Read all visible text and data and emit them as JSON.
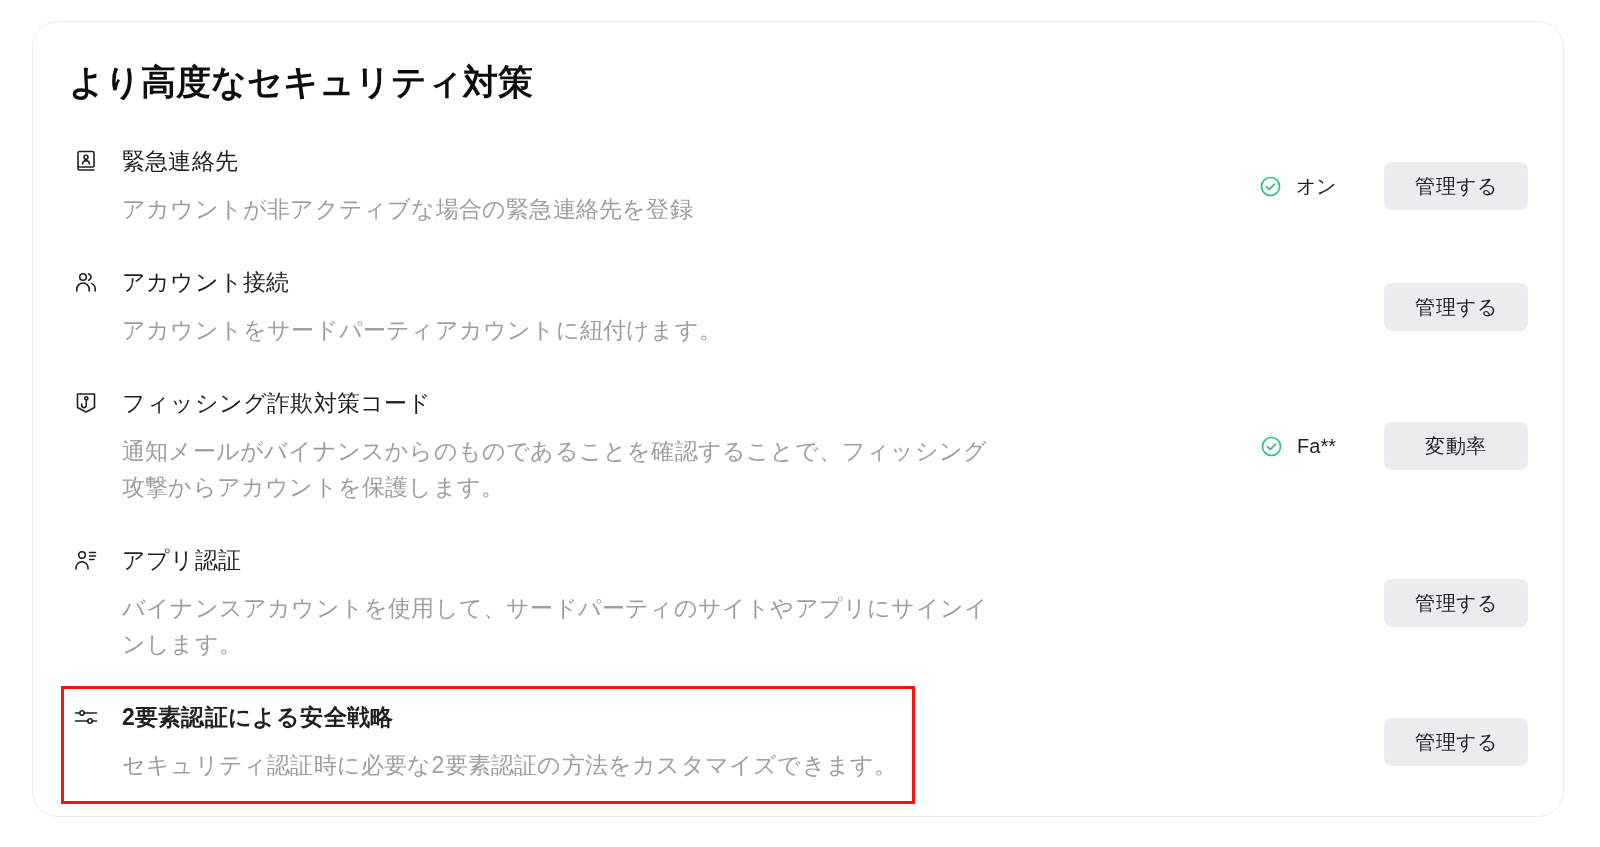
{
  "section": {
    "title": "より高度なセキュリティ対策"
  },
  "items": [
    {
      "title": "緊急連絡先",
      "description": "アカウントが非アクティブな場合の緊急連絡先を登録",
      "status": {
        "text": "オン"
      },
      "button": "管理する",
      "emphasized": false,
      "highlighted": false
    },
    {
      "title": "アカウント接続",
      "description": "アカウントをサードパーティアカウントに紐付けます。",
      "button": "管理する",
      "emphasized": false,
      "highlighted": false
    },
    {
      "title": "フィッシング詐欺対策コード",
      "description": "通知メールがバイナンスからのものであることを確認することで、フィッシング攻撃からアカウントを保護します。",
      "status": {
        "text": "Fa**"
      },
      "button": "変動率",
      "emphasized": false,
      "highlighted": false
    },
    {
      "title": "アプリ認証",
      "description": "バイナンスアカウントを使用して、サードパーティのサイトやアプリにサインインします。",
      "button": "管理する",
      "emphasized": false,
      "highlighted": false
    },
    {
      "title": "2要素認証による安全戦略",
      "description": "セキュリティ認証時に必要な2要素認証の方法をカスタマイズできます。",
      "button": "管理する",
      "emphasized": true,
      "highlighted": true
    }
  ]
}
